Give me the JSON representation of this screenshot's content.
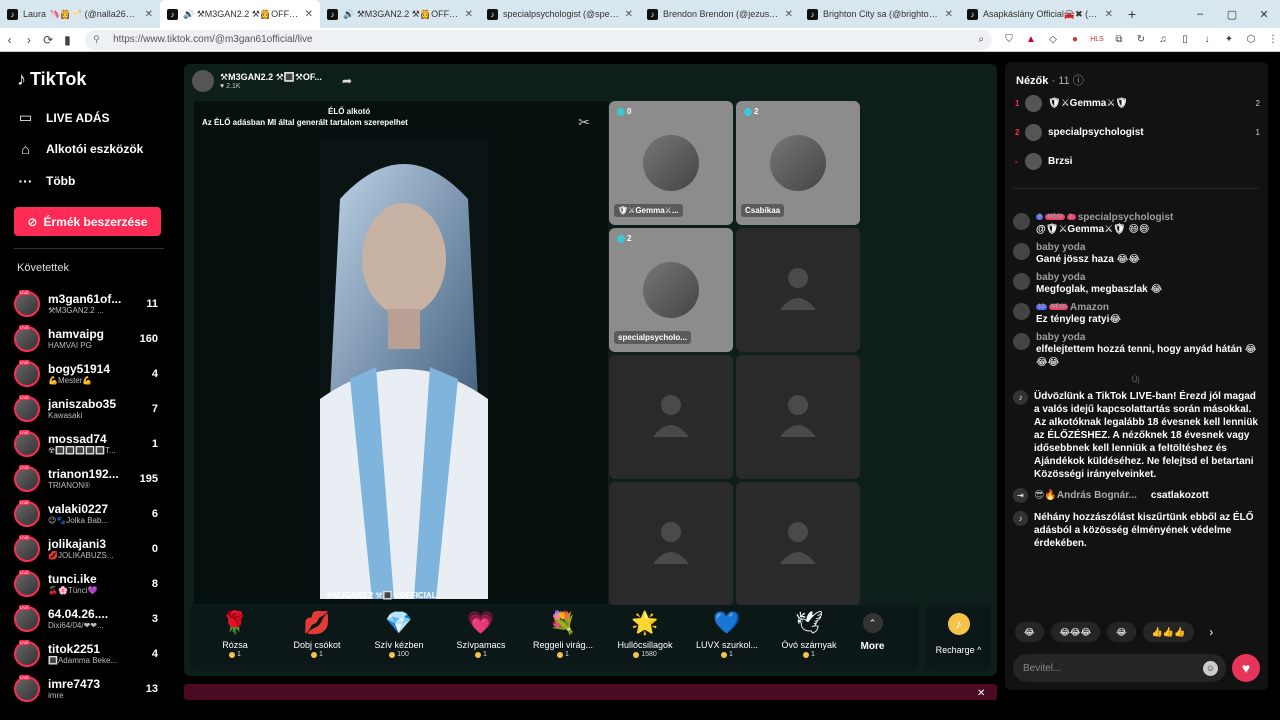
{
  "browser": {
    "tabs": [
      {
        "title": "Laura 🦄👸🥂 (@nalla2635) ÉLŐ ad",
        "active": false
      },
      {
        "title": "🔊 ⚒M3GAN2.2 ⚒👸OFFICIAL",
        "active": true
      },
      {
        "title": "🔊 ⚒M3GAN2.2 ⚒👸OFFICIAL",
        "active": false
      },
      {
        "title": "specialpsychologist (@specialpsych",
        "active": false
      },
      {
        "title": "Brendon Brendon (@jezusamegvalt",
        "active": false
      },
      {
        "title": "Brighton City sa (@brighton.city) ÉL",
        "active": false
      },
      {
        "title": "Asapkáslány Official🚘✖ (@theo",
        "active": false
      }
    ],
    "url": "https://www.tiktok.com/@m3gan61official/live"
  },
  "sidebar": {
    "logo": "TikTok",
    "nav": [
      {
        "label": "LIVE ADÁS",
        "icon": "video-camera-icon"
      },
      {
        "label": "Alkotói eszközök",
        "icon": "home-icon"
      },
      {
        "label": "Több",
        "icon": "more-dots-icon"
      }
    ],
    "coins_button": "Érmék beszerzése",
    "following_header": "Követettek",
    "following": [
      {
        "name": "m3gan61of...",
        "sub": "⚒M3GAN2.2 ...",
        "count": "11"
      },
      {
        "name": "hamvaipg",
        "sub": "HAMVAI PG",
        "count": "160"
      },
      {
        "name": "bogy51914",
        "sub": "💪Mester💪",
        "count": "4"
      },
      {
        "name": "janiszabo35",
        "sub": "Kawasaki",
        "count": "7"
      },
      {
        "name": "mossad74",
        "sub": "☢🔳🔳🔳🔳🔳T...",
        "count": "1"
      },
      {
        "name": "trianon192...",
        "sub": "TRIANON®",
        "count": "195"
      },
      {
        "name": "valaki0227",
        "sub": "😉🐾Jolka Bab...",
        "count": "6"
      },
      {
        "name": "jolikajani3",
        "sub": "💋JOLIKABUZS...",
        "count": "0"
      },
      {
        "name": "tunci.ike",
        "sub": "🍒🌸Tünci💜",
        "count": "8"
      },
      {
        "name": "64.04.26....",
        "sub": "Dixi64/04/❤❤...",
        "count": "3"
      },
      {
        "name": "titok2251",
        "sub": "🔳Adamma Beke...",
        "count": "4"
      },
      {
        "name": "imre7473",
        "sub": "imre",
        "count": "13"
      }
    ]
  },
  "host": {
    "name": "⚒M3GAN2.2 ⚒🔳⚒OF...",
    "likes": "♥ 2.1K"
  },
  "video": {
    "ai_notice": "Az ÉLŐ adásban MI által generált tartalom szerepelhet",
    "live_label": "ÉLŐ alkotó",
    "caption": "⚒M3GAN2.2 ⚒🔳⚒OFFICIAL"
  },
  "guests": [
    {
      "count": "0",
      "name": "🛡⚔Gemma⚔...",
      "active": true
    },
    {
      "count": "2",
      "name": "Csabikaa",
      "active": true
    },
    {
      "count": "2",
      "name": "specialpsycholo...",
      "active": true
    },
    {
      "count": "",
      "name": "",
      "active": false
    },
    {
      "count": "",
      "name": "",
      "active": false
    },
    {
      "count": "",
      "name": "",
      "active": false
    },
    {
      "count": "",
      "name": "",
      "active": false
    },
    {
      "count": "",
      "name": "",
      "active": false
    }
  ],
  "gifts": [
    {
      "icon": "🌹",
      "name": "Rózsa",
      "price": "1"
    },
    {
      "icon": "💋",
      "name": "Dobj csókot",
      "price": "1"
    },
    {
      "icon": "💎",
      "name": "Szív kézben",
      "price": "100"
    },
    {
      "icon": "💗",
      "name": "Szívpamacs",
      "price": "1"
    },
    {
      "icon": "💐",
      "name": "Reggeli virág...",
      "price": "1"
    },
    {
      "icon": "🌟",
      "name": "Hullócsillagok",
      "price": "1580"
    },
    {
      "icon": "💙",
      "name": "LUVX szurkol...",
      "price": "1"
    },
    {
      "icon": "🕊",
      "name": "Óvó szárnyak",
      "price": "1"
    }
  ],
  "more_label": "More",
  "recharge_label": "Recharge ^",
  "chat": {
    "viewers_label": "Nézők",
    "viewers_count": "11",
    "top_viewers": [
      {
        "rank": "1",
        "name": "🛡⚔Gemma⚔🛡",
        "score": "2"
      },
      {
        "rank": "2",
        "name": "specialpsychologist",
        "score": "1"
      },
      {
        "rank": "-",
        "name": "Brzsi",
        "score": ""
      }
    ],
    "messages": [
      {
        "user": "specialpsychologist",
        "badges": [
          "9",
          "MEGI",
          "2."
        ],
        "text": "@🛡⚔Gemma⚔🛡 😄😄"
      },
      {
        "user": "baby yoda",
        "badges": [],
        "text": "Gané jössz haza 😂😂"
      },
      {
        "user": "baby yoda",
        "badges": [],
        "text": "Megfoglak, megbaszlak 😂"
      },
      {
        "user": "Amazon",
        "badges": [
          "13",
          "MEGI"
        ],
        "text": "Ez tényleg ratyi😂"
      },
      {
        "user": "baby yoda",
        "badges": [],
        "text": "elfelejtettem hozzá tenni, hogy anyád hátán 😂😂😂"
      }
    ],
    "new_label": "Új",
    "welcome": "Üdvözlünk a TikTok LIVE-ban! Érezd jól magad a valós idejű kapcsolattartás során másokkal. Az alkotóknak legalább 18 évesnek kell lenniük az ÉLŐZÉSHEZ. A nézőknek 18 évesnek vagy idősebbnek kell lenniük a feltöltéshez és Ajándékok küldéséhez. Ne felejtsd el betartani Közösségi irányelveinket.",
    "joined_user": "😎🔥András Bognár...",
    "joined_text": "csatlakozott",
    "filter_notice": "Néhány hozzászólást kiszűrtünk ebből az ÉLŐ adásból a közösség élményének védelme érdekében.",
    "quick_reactions": [
      "😂",
      "😂😂😂",
      "😂",
      "👍👍👍"
    ],
    "input_placeholder": "Bevitel..."
  }
}
